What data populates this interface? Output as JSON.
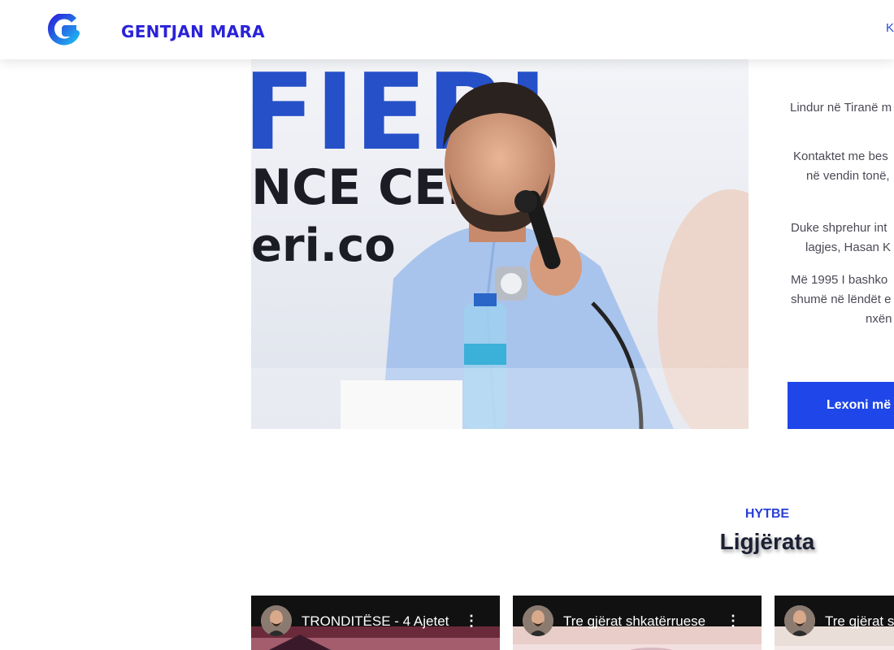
{
  "header": {
    "brand": "GENTJAN MARA",
    "nav_partial": "K"
  },
  "hero": {
    "photo_alt": "",
    "bio_lines": [
      "Lindur në Tiranë m",
      "Kontaktet me bes",
      "në vendin tonë,",
      "Duke shprehur int",
      "lagjes, Hasan K",
      "Më 1995 I bashko",
      "shumë në lëndët e",
      "nxën"
    ],
    "read_more": "Lexoni më"
  },
  "section": {
    "kicker": "HYTBE",
    "title": "Ligjërata"
  },
  "videos": [
    {
      "title": "TRONDITËSE - 4 Ajetet",
      "menu_icon": "kebab-menu-icon"
    },
    {
      "title": "Tre gjërat shkatërruese",
      "menu_icon": "kebab-menu-icon"
    },
    {
      "title": "Tre gjërat s",
      "menu_icon": "kebab-menu-icon"
    }
  ],
  "colors": {
    "brand": "#2a22d9",
    "accent": "#1f46e8",
    "kicker": "#2a3fd6",
    "title": "#1c2033"
  }
}
